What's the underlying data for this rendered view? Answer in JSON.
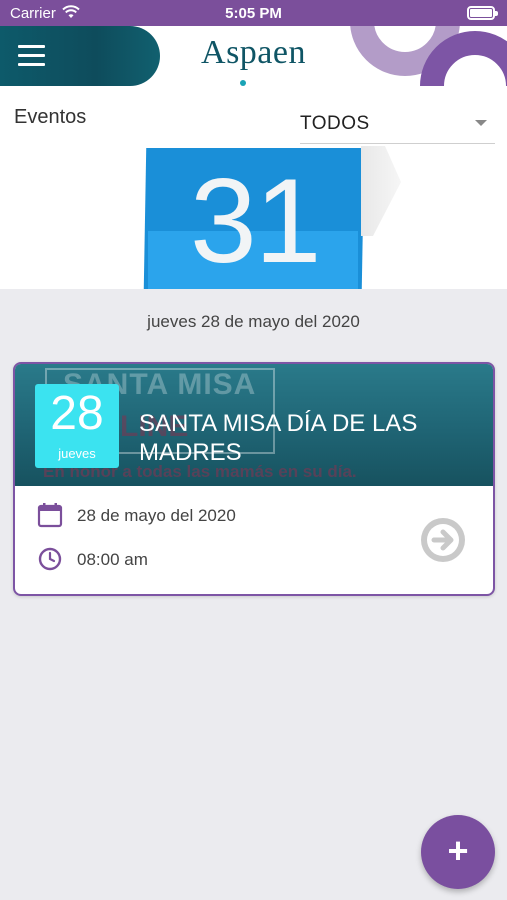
{
  "status_bar": {
    "carrier": "Carrier",
    "time": "5:05 PM"
  },
  "header": {
    "logo": "Aspaen",
    "icons": [
      "menu-icon"
    ]
  },
  "events": {
    "title": "Eventos",
    "filter": {
      "selected": "TODOS"
    }
  },
  "banner": {
    "calendar_number": "31"
  },
  "date_group": {
    "label": "jueves 28 de mayo del 2020"
  },
  "event_card": {
    "image_text": {
      "line1": "SANTA MISA",
      "line2": "ONLINE",
      "line3": "En honor a todas las mamás en su día."
    },
    "badge": {
      "day": "28",
      "weekday": "jueves"
    },
    "title": "SANTA MISA DÍA DE LAS MADRES",
    "date": "28 de mayo del 2020",
    "time": "08:00 am"
  },
  "fab": {
    "label": "+"
  },
  "colors": {
    "primary": "#7b4f9b",
    "teal": "#0f5565",
    "badge": "#3be3f0"
  }
}
